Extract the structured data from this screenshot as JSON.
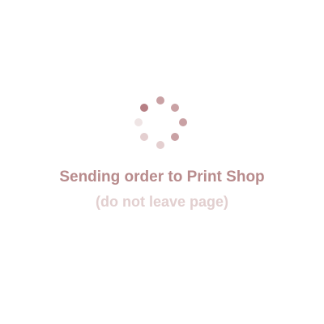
{
  "loader": {
    "title": "Sending order to Print Shop",
    "subtitle": "(do not leave page)",
    "spinner_icon": "loading-spinner-icon",
    "colors": {
      "title": "#b88b8c",
      "subtitle": "#e2cfcf",
      "dot_dark": "#b67f84",
      "dot_medium": "#c9a1a4",
      "dot_light": "#e4cfd0",
      "dot_faint": "#efe5e5"
    }
  }
}
